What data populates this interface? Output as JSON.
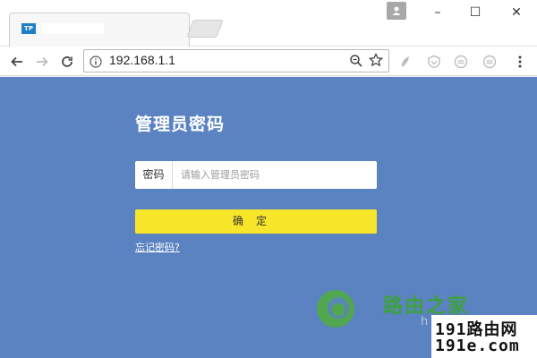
{
  "browser": {
    "tab": {
      "favicon_text": "TP"
    },
    "window_controls": {
      "minimize": "–",
      "maximize": "☐",
      "close": "✕"
    },
    "address": {
      "url": "192.168.1.1"
    },
    "icons": {
      "back": "back-arrow-icon",
      "forward": "forward-arrow-icon",
      "reload": "reload-icon",
      "info": "info-icon",
      "zoom": "zoom-icon",
      "bookmark": "star-icon",
      "menu": "menu-dots-icon"
    }
  },
  "login": {
    "title": "管理员密码",
    "password_label": "密码",
    "password_placeholder": "请输入管理员密码",
    "password_value": "",
    "confirm_label": "确定",
    "forgot_link": "忘记密码?"
  },
  "watermark": {
    "brand_cn": "路由之家",
    "brand_partial": "h",
    "site_line1": "191路由网",
    "site_line2": "191e.com"
  },
  "colors": {
    "page_background": "#5b82c1",
    "confirm_button": "#f7e629",
    "brand_green": "#3ea13e"
  }
}
